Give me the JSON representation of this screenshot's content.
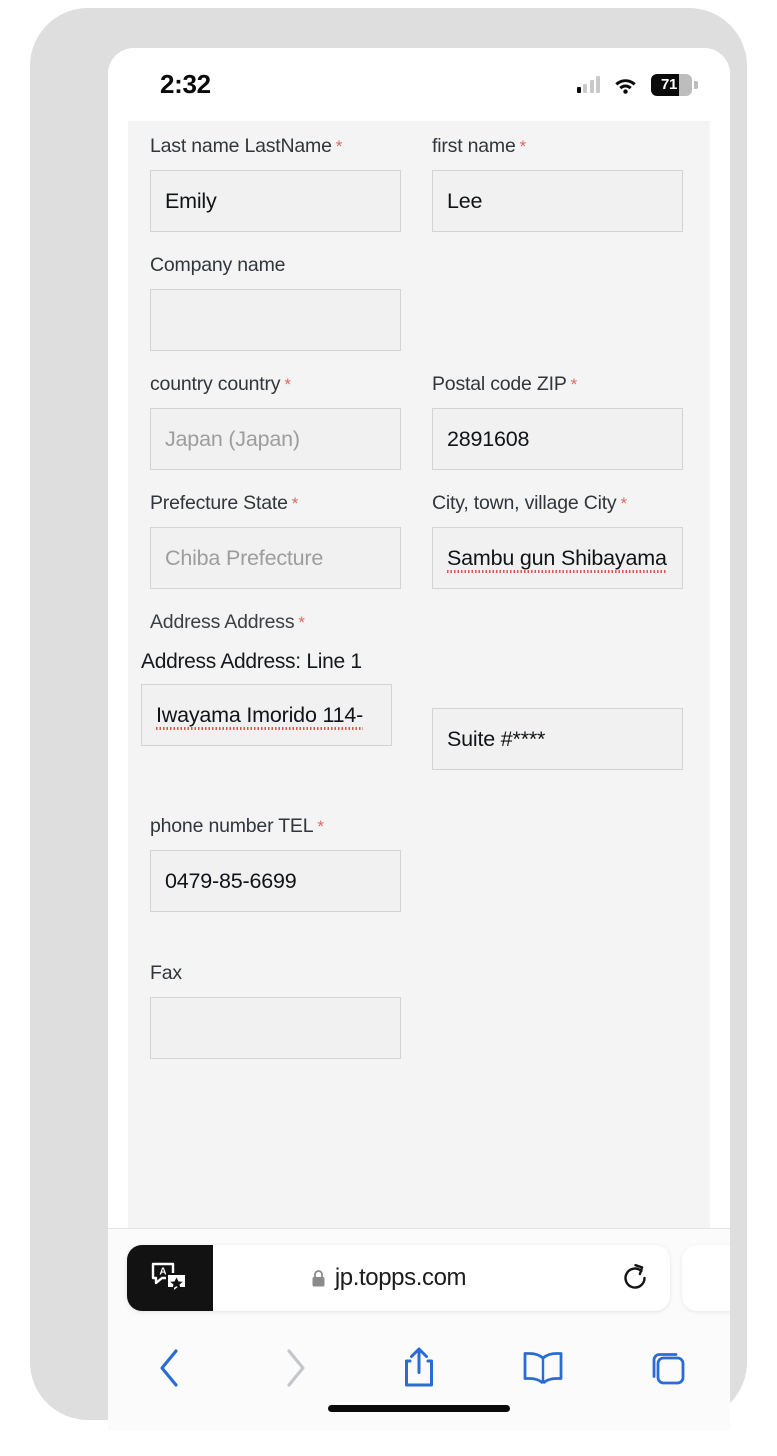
{
  "status_bar": {
    "time": "2:32",
    "battery_level": "71",
    "signal_icon": "cellular-signal-icon",
    "wifi_icon": "wifi-icon",
    "battery_icon": "battery-icon"
  },
  "form": {
    "fields": [
      {
        "id": "last-name",
        "label": "Last name LastName",
        "required": true,
        "value": "Emily",
        "is_placeholder": false,
        "misspelled": false
      },
      {
        "id": "first-name",
        "label": "first name",
        "required": true,
        "value": "Lee",
        "is_placeholder": false,
        "misspelled": false
      },
      {
        "id": "company-name",
        "label": "Company name",
        "required": false,
        "value": "",
        "is_placeholder": false,
        "misspelled": false
      },
      {
        "id": "country",
        "label": "country country",
        "required": true,
        "value": "Japan (Japan)",
        "is_placeholder": true,
        "misspelled": false
      },
      {
        "id": "postal-code",
        "label": "Postal code ZIP",
        "required": true,
        "value": "2891608",
        "is_placeholder": false,
        "misspelled": false
      },
      {
        "id": "prefecture",
        "label": "Prefecture State",
        "required": true,
        "value": "Chiba Prefecture",
        "is_placeholder": true,
        "misspelled": false
      },
      {
        "id": "city",
        "label": "City, town, village City",
        "required": true,
        "value": "Sambu gun Shibayama",
        "is_placeholder": false,
        "misspelled": true
      },
      {
        "id": "phone",
        "label": "phone number TEL",
        "required": true,
        "value": "0479-85-6699",
        "is_placeholder": false,
        "misspelled": false
      },
      {
        "id": "fax",
        "label": "Fax",
        "required": false,
        "value": "",
        "is_placeholder": false,
        "misspelled": false
      }
    ],
    "address_group": {
      "label": "Address Address",
      "required": true,
      "line1_label": "Address Address: Line 1",
      "line1_value": "Iwayama Imorido 114-",
      "line1_misspelled": true,
      "line2_value": "Suite #****"
    },
    "required_marker": "*"
  },
  "browser": {
    "url": "jp.topps.com",
    "lock_icon": "lock-icon",
    "translate_icon": "translate-icon",
    "reload_icon": "reload-icon",
    "toolbar": [
      {
        "id": "back",
        "icon": "back-chevron-icon",
        "color": "#2a6bd4",
        "enabled": true
      },
      {
        "id": "forward",
        "icon": "forward-chevron-icon",
        "color": "#c3c7cc",
        "enabled": false
      },
      {
        "id": "share",
        "icon": "share-icon",
        "color": "#2a6bd4",
        "enabled": true
      },
      {
        "id": "bookmarks",
        "icon": "book-icon",
        "color": "#2a6bd4",
        "enabled": true
      },
      {
        "id": "tabs",
        "icon": "tabs-icon",
        "color": "#2a6bd4",
        "enabled": true
      }
    ]
  },
  "colors": {
    "accent_blue": "#2a6bd4",
    "required_red": "#e0685f",
    "spellcheck_red": "#d9544a",
    "page_bg": "#f4f4f4",
    "field_bg": "#f1f1f1",
    "field_border": "#d3d3d3"
  }
}
